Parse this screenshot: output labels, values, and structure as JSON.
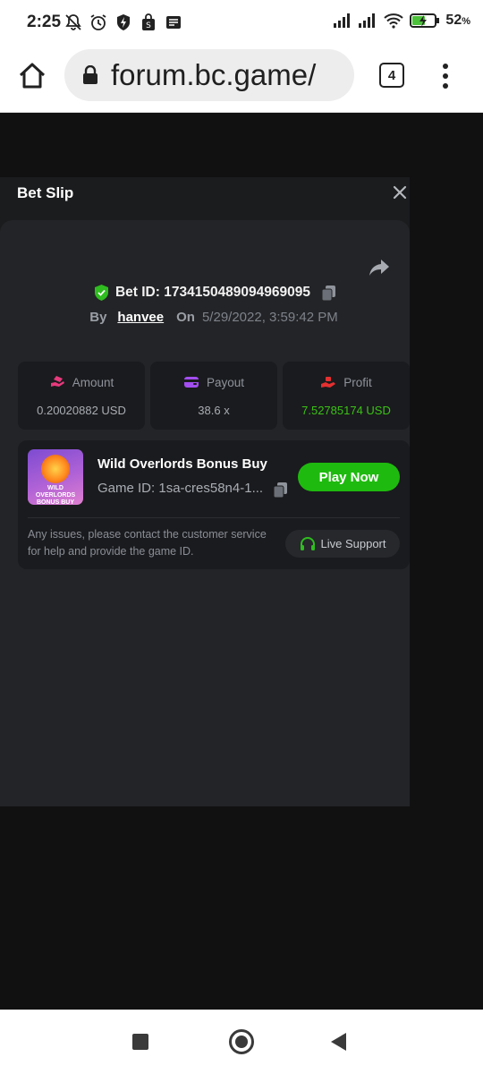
{
  "status_bar": {
    "time": "2:25",
    "battery_percent": "52",
    "battery_suffix": "%",
    "icons": [
      "bell-off-icon",
      "alarm-icon",
      "shield-flash-icon",
      "shopping-bag-icon",
      "message-icon",
      "signal-icon",
      "signal-icon",
      "wifi-icon",
      "battery-charging-icon"
    ]
  },
  "browser": {
    "url": "forum.bc.game/",
    "tab_count": "4"
  },
  "modal": {
    "title": "Bet Slip",
    "bet_id_label": "Bet ID: 1734150489094969095",
    "by_label": "By",
    "username": "hanvee",
    "on_label": "On",
    "date": "5/29/2022, 3:59:42 PM",
    "stats": [
      {
        "label": "Amount",
        "value": "0.20020882 USD",
        "icon": "money-hand-icon",
        "icon_color": "#e73a7c"
      },
      {
        "label": "Payout",
        "value": "38.6 x",
        "icon": "wallet-icon",
        "icon_color": "#a34ef0"
      },
      {
        "label": "Profit",
        "value": "7.52785174 USD",
        "icon": "money-hand-icon",
        "icon_color": "#e53030",
        "value_color": "#3bc117"
      }
    ],
    "game": {
      "thumb_text": "WILD OVERLORDS BONUS BUY",
      "name": "Wild Overlords Bonus Buy",
      "id_label": "Game ID: 1sa-cres58n4-1...",
      "play_label": "Play Now",
      "issue_text": "Any issues, please contact the customer service for help and provide the game ID.",
      "support_label": "Live Support"
    }
  },
  "colors": {
    "accent_green": "#1fba0f",
    "profit_green": "#3bc117",
    "modal_bg": "#1b1c1e",
    "card_bg": "#1a1b1e"
  }
}
